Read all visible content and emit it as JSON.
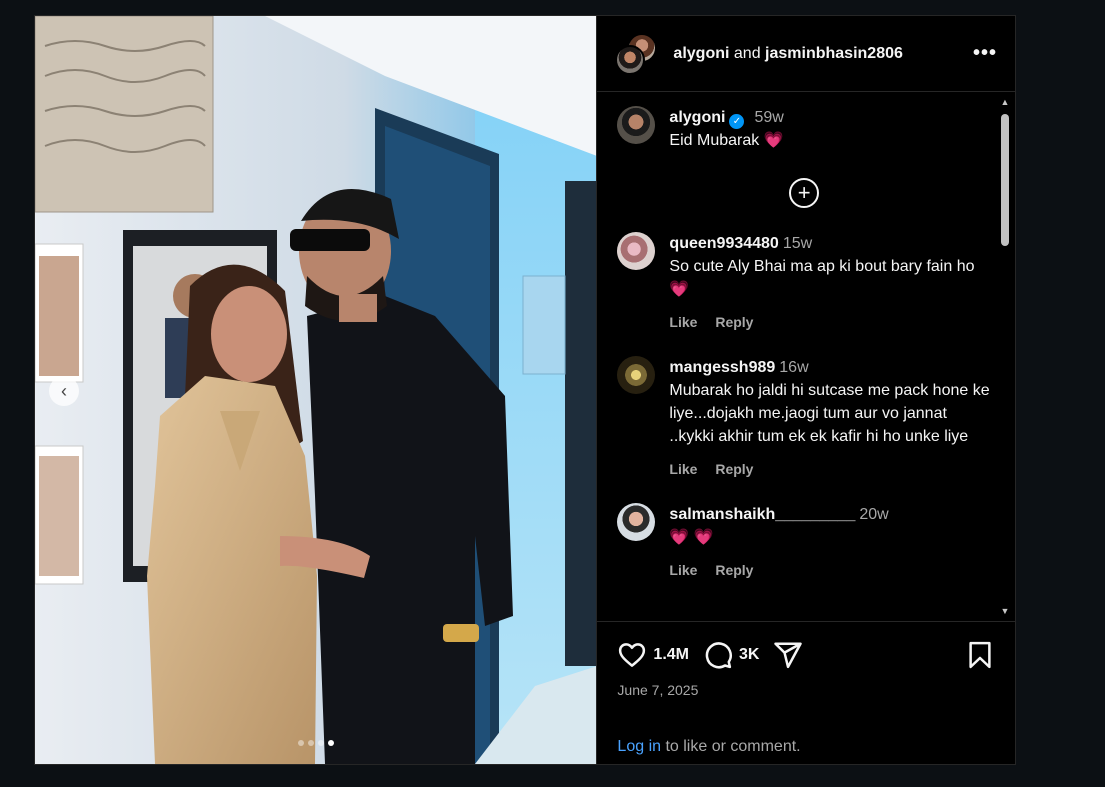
{
  "header": {
    "user1": "alygoni",
    "joiner": "and",
    "user2": "jasminbhasin2806",
    "more_label": "•••"
  },
  "caption": {
    "username": "alygoni",
    "verified": "✓",
    "time": "59w",
    "text": "Eid Mubarak 💗"
  },
  "load_more": "+",
  "comments": [
    {
      "username": "queen9934480",
      "time": "15w",
      "text": "So cute Aly Bhai ma ap ki bout bary fain ho 💗",
      "like": "Like",
      "reply": "Reply"
    },
    {
      "username": "mangessh989",
      "time": "16w",
      "text": "Mubarak ho jaldi hi sutcase me pack hone ke liye...dojakh me.jaogi tum aur vo jannat ..kykki akhir tum ek ek kafir hi ho unke liye",
      "like": "Like",
      "reply": "Reply"
    },
    {
      "username": "salmanshaikh_________",
      "time": "20w",
      "text": "💗 💗",
      "like": "Like",
      "reply": "Reply"
    }
  ],
  "footer": {
    "likes": "1.4M",
    "comments": "3K",
    "date": "June 7, 2025",
    "login_link": "Log in",
    "login_rest": " to like or comment."
  },
  "icons": [
    "heart-icon",
    "comment-icon",
    "share-icon",
    "bookmark-icon",
    "chevron-left-icon",
    "plus-circle-icon",
    "more-icon"
  ],
  "media": {
    "slide_count": 4,
    "active_slide": 4
  }
}
